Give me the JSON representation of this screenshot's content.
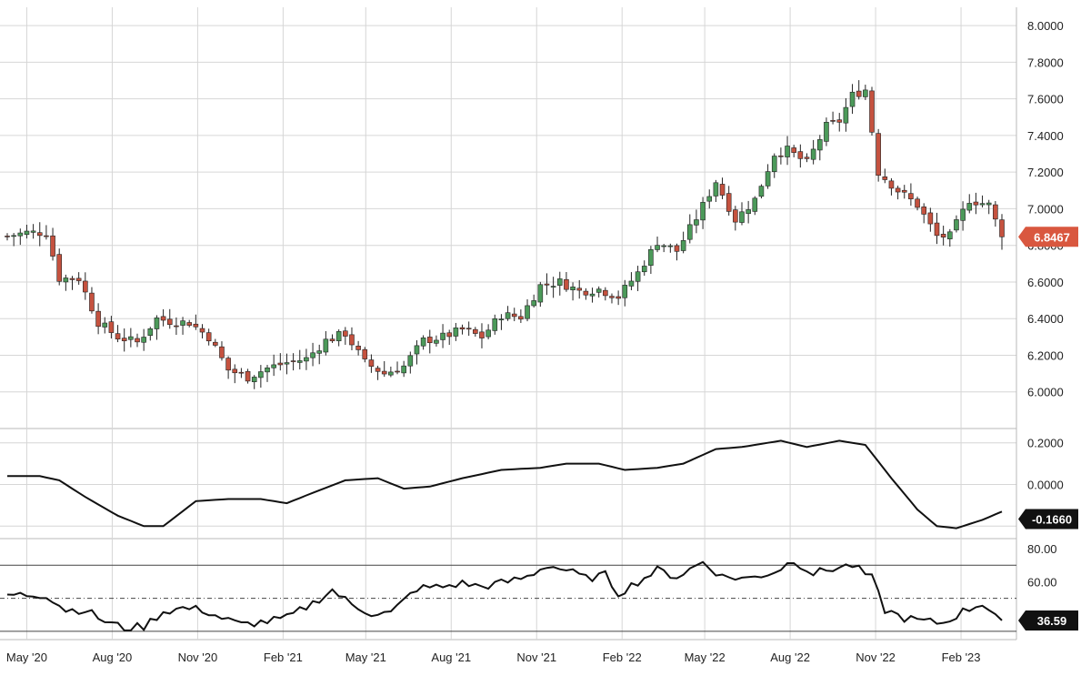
{
  "chart_data": {
    "type": "candlestick",
    "grid": true,
    "colors": {
      "up": "#4c9a5a",
      "down": "#c5523f",
      "line": "#111111",
      "price_badge": "#d9573f",
      "dark_badge": "#111111",
      "grid": "#d6d6d6",
      "overbought_fill": "#bdbdbd"
    },
    "x_labels": [
      {
        "date": "2020-05-01",
        "label": "May '20"
      },
      {
        "date": "2020-08-01",
        "label": "Aug '20"
      },
      {
        "date": "2020-11-01",
        "label": "Nov '20"
      },
      {
        "date": "2021-02-01",
        "label": "Feb '21"
      },
      {
        "date": "2021-05-01",
        "label": "May '21"
      },
      {
        "date": "2021-08-01",
        "label": "Aug '21"
      },
      {
        "date": "2021-11-01",
        "label": "Nov '21"
      },
      {
        "date": "2022-02-01",
        "label": "Feb '22"
      },
      {
        "date": "2022-05-01",
        "label": "May '22"
      },
      {
        "date": "2022-08-01",
        "label": "Aug '22"
      },
      {
        "date": "2022-11-01",
        "label": "Nov '22"
      },
      {
        "date": "2023-02-01",
        "label": "Feb '23"
      }
    ],
    "price": {
      "ylim": [
        5.8,
        8.1
      ],
      "ticks": [
        "6.0000",
        "6.2000",
        "6.4000",
        "6.6000",
        "6.8000",
        "7.0000",
        "7.2000",
        "7.4000",
        "7.6000",
        "7.8000",
        "8.0000"
      ],
      "last_value": 6.8467,
      "last_label": "6.8467",
      "close_anchors": [
        [
          "2020-04-10",
          6.85
        ],
        [
          "2020-05-01",
          6.87
        ],
        [
          "2020-05-22",
          6.87
        ],
        [
          "2020-06-05",
          6.62
        ],
        [
          "2020-06-26",
          6.62
        ],
        [
          "2020-07-17",
          6.38
        ],
        [
          "2020-08-07",
          6.3
        ],
        [
          "2020-08-28",
          6.27
        ],
        [
          "2020-09-18",
          6.4
        ],
        [
          "2020-10-09",
          6.38
        ],
        [
          "2020-10-23",
          6.38
        ],
        [
          "2020-11-13",
          6.3
        ],
        [
          "2020-12-04",
          6.12
        ],
        [
          "2020-12-25",
          6.08
        ],
        [
          "2021-01-15",
          6.13
        ],
        [
          "2021-02-05",
          6.16
        ],
        [
          "2021-02-26",
          6.18
        ],
        [
          "2021-03-19",
          6.28
        ],
        [
          "2021-04-09",
          6.32
        ],
        [
          "2021-04-30",
          6.16
        ],
        [
          "2021-05-21",
          6.1
        ],
        [
          "2021-06-11",
          6.14
        ],
        [
          "2021-07-02",
          6.28
        ],
        [
          "2021-07-23",
          6.3
        ],
        [
          "2021-08-13",
          6.34
        ],
        [
          "2021-09-03",
          6.3
        ],
        [
          "2021-09-24",
          6.42
        ],
        [
          "2021-10-15",
          6.41
        ],
        [
          "2021-11-05",
          6.58
        ],
        [
          "2021-11-26",
          6.6
        ],
        [
          "2021-12-17",
          6.55
        ],
        [
          "2022-01-07",
          6.56
        ],
        [
          "2022-01-28",
          6.52
        ],
        [
          "2022-02-18",
          6.65
        ],
        [
          "2022-03-11",
          6.82
        ],
        [
          "2022-04-01",
          6.77
        ],
        [
          "2022-04-22",
          6.95
        ],
        [
          "2022-05-13",
          7.15
        ],
        [
          "2022-06-03",
          6.94
        ],
        [
          "2022-06-24",
          7.05
        ],
        [
          "2022-07-15",
          7.3
        ],
        [
          "2022-07-29",
          7.32
        ],
        [
          "2022-08-19",
          7.25
        ],
        [
          "2022-09-09",
          7.45
        ],
        [
          "2022-09-23",
          7.48
        ],
        [
          "2022-10-07",
          7.62
        ],
        [
          "2022-10-21",
          7.65
        ],
        [
          "2022-11-04",
          7.2
        ],
        [
          "2022-11-25",
          7.1
        ],
        [
          "2022-12-16",
          7.02
        ],
        [
          "2023-01-06",
          6.85
        ],
        [
          "2023-01-20",
          6.85
        ],
        [
          "2023-02-10",
          7.05
        ],
        [
          "2023-03-03",
          7.02
        ],
        [
          "2023-03-17",
          6.85
        ]
      ]
    },
    "oscillator": {
      "ylim": [
        -0.26,
        0.26
      ],
      "ticks": [
        "0.2000",
        "0.0000"
      ],
      "last_value": -0.166,
      "last_label": "-0.1660",
      "anchors": [
        [
          "2020-04-10",
          0.04
        ],
        [
          "2020-05-15",
          0.04
        ],
        [
          "2020-06-05",
          0.02
        ],
        [
          "2020-07-03",
          -0.06
        ],
        [
          "2020-08-07",
          -0.15
        ],
        [
          "2020-09-04",
          -0.2
        ],
        [
          "2020-09-25",
          -0.2
        ],
        [
          "2020-10-30",
          -0.08
        ],
        [
          "2020-12-04",
          -0.07
        ],
        [
          "2021-01-08",
          -0.07
        ],
        [
          "2021-02-05",
          -0.09
        ],
        [
          "2021-03-05",
          -0.04
        ],
        [
          "2021-04-09",
          0.02
        ],
        [
          "2021-05-14",
          0.03
        ],
        [
          "2021-06-11",
          -0.02
        ],
        [
          "2021-07-09",
          -0.01
        ],
        [
          "2021-08-13",
          0.03
        ],
        [
          "2021-09-24",
          0.07
        ],
        [
          "2021-11-05",
          0.08
        ],
        [
          "2021-12-03",
          0.1
        ],
        [
          "2022-01-07",
          0.1
        ],
        [
          "2022-02-04",
          0.07
        ],
        [
          "2022-03-11",
          0.08
        ],
        [
          "2022-04-08",
          0.1
        ],
        [
          "2022-05-13",
          0.17
        ],
        [
          "2022-06-10",
          0.18
        ],
        [
          "2022-07-22",
          0.21
        ],
        [
          "2022-08-19",
          0.18
        ],
        [
          "2022-09-23",
          0.21
        ],
        [
          "2022-10-21",
          0.19
        ],
        [
          "2022-11-18",
          0.03
        ],
        [
          "2022-12-16",
          -0.12
        ],
        [
          "2023-01-06",
          -0.2
        ],
        [
          "2023-01-27",
          -0.21
        ],
        [
          "2023-02-24",
          -0.17
        ],
        [
          "2023-03-17",
          -0.13
        ]
      ]
    },
    "rsi": {
      "ylim": [
        25,
        85
      ],
      "ticks": [
        "80.00",
        "60.00"
      ],
      "upper_level": 70,
      "mid_level": 50,
      "lower_level": 30,
      "last_value": 36.59,
      "last_label": "36.59",
      "anchors": [
        [
          "2020-04-10",
          52
        ],
        [
          "2020-05-01",
          52
        ],
        [
          "2020-05-22",
          52
        ],
        [
          "2020-06-12",
          43
        ],
        [
          "2020-07-03",
          43
        ],
        [
          "2020-07-24",
          36
        ],
        [
          "2020-08-14",
          32
        ],
        [
          "2020-09-04",
          33
        ],
        [
          "2020-09-25",
          42
        ],
        [
          "2020-10-16",
          44
        ],
        [
          "2020-11-06",
          43
        ],
        [
          "2020-11-27",
          38
        ],
        [
          "2020-12-18",
          34
        ],
        [
          "2021-01-15",
          36
        ],
        [
          "2021-02-05",
          38
        ],
        [
          "2021-03-05",
          47
        ],
        [
          "2021-03-26",
          55
        ],
        [
          "2021-04-16",
          46
        ],
        [
          "2021-05-07",
          41
        ],
        [
          "2021-05-28",
          41
        ],
        [
          "2021-06-25",
          56
        ],
        [
          "2021-07-23",
          57
        ],
        [
          "2021-08-13",
          59
        ],
        [
          "2021-09-03",
          57
        ],
        [
          "2021-10-01",
          60
        ],
        [
          "2021-10-22",
          63
        ],
        [
          "2021-11-12",
          70
        ],
        [
          "2021-12-03",
          67
        ],
        [
          "2021-12-24",
          62
        ],
        [
          "2022-01-14",
          64
        ],
        [
          "2022-01-28",
          53
        ],
        [
          "2022-02-18",
          60
        ],
        [
          "2022-03-11",
          67
        ],
        [
          "2022-04-01",
          63
        ],
        [
          "2022-04-29",
          72
        ],
        [
          "2022-05-20",
          63
        ],
        [
          "2022-06-17",
          62
        ],
        [
          "2022-07-15",
          66
        ],
        [
          "2022-08-05",
          73
        ],
        [
          "2022-08-26",
          65
        ],
        [
          "2022-09-16",
          68
        ],
        [
          "2022-10-07",
          70
        ],
        [
          "2022-10-28",
          62
        ],
        [
          "2022-11-11",
          43
        ],
        [
          "2022-12-02",
          38
        ],
        [
          "2022-12-23",
          36
        ],
        [
          "2023-01-13",
          35
        ],
        [
          "2023-02-03",
          42
        ],
        [
          "2023-02-24",
          47
        ],
        [
          "2023-03-17",
          37
        ]
      ]
    }
  }
}
